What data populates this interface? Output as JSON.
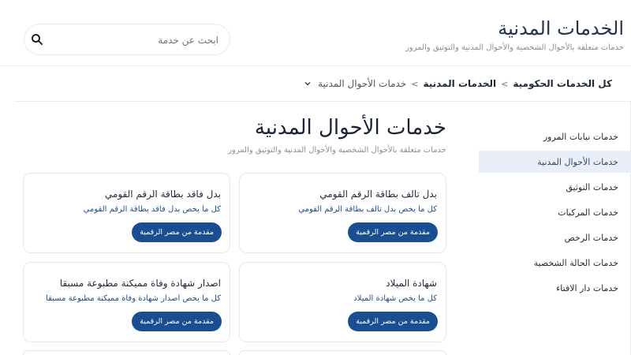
{
  "header": {
    "title": "الخدمات المدنية",
    "subtitle": "خدمات متعلقة بالأحوال الشخصية والأحوال المدنية والتوثيق والمرور",
    "search": {
      "placeholder": "ابحث عن خدمة",
      "icon": "search-icon"
    }
  },
  "breadcrumb": {
    "items": [
      "كل الخدمات الحكومية",
      "الخدمات المدنية"
    ],
    "current": "خدمات الأحوال المدنية",
    "separator": ">"
  },
  "sidebar": {
    "items": [
      {
        "label": "خدمات نيابات المرور",
        "active": false
      },
      {
        "label": "خدمات الأحوال المدنية",
        "active": true
      },
      {
        "label": "خدمات التوثيق",
        "active": false
      },
      {
        "label": "خدمات المركبات",
        "active": false
      },
      {
        "label": "خدمات الرخص",
        "active": false
      },
      {
        "label": "خدمات الحالة الشخصية",
        "active": false
      },
      {
        "label": "خدمات دار الافتاء",
        "active": false
      }
    ]
  },
  "main": {
    "title": "خدمات الأحوال المدنية",
    "subtitle": "خدمات متعلقة بالأحوال الشخصية والأحوال المدنية والتوثيق والمرور",
    "cards": [
      {
        "title": "بدل تالف بطاقة الرقم القومي",
        "desc": "كل ما يخص بدل تالف بطاقة الرقم القومي",
        "badge": "مقدمة من مصر الرقمية"
      },
      {
        "title": "بدل فاقد بطاقة الرقم القومي",
        "desc": "كل ما يخص بدل فاقد بطاقة الرقم القومي",
        "badge": "مقدمة من مصر الرقمية"
      },
      {
        "title": "شهادة الميلاد",
        "desc": "كل ما يخص شهادة الميلاد",
        "badge": "مقدمة من مصر الرقمية"
      },
      {
        "title": "اصدار شهادة وفاة مميكنة مطبوعة مسبقا",
        "desc": "كل ما يخص اصدار شهادة وفاة مميكنة مطبوعة مسبقا",
        "badge": "مقدمة من مصر الرقمية"
      }
    ]
  },
  "colors": {
    "brand_blue": "#1a4e93",
    "link_blue": "#1d4f91",
    "active_bg": "#e9eef8",
    "border": "#e6e8ec"
  }
}
